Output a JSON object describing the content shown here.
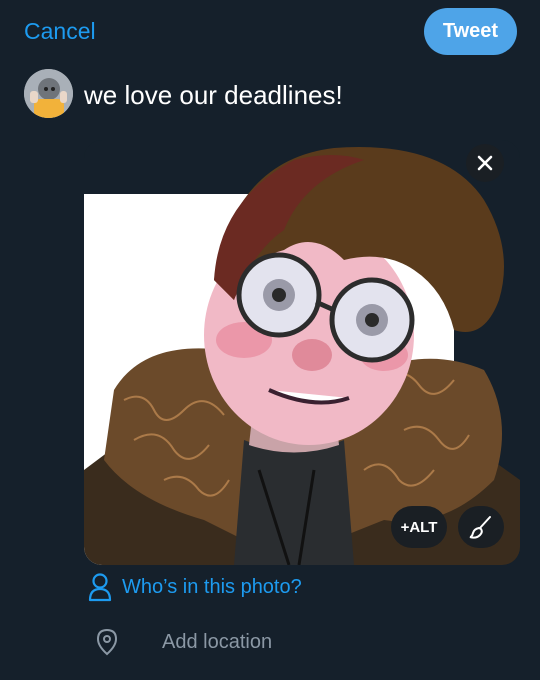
{
  "header": {
    "cancel_label": "Cancel",
    "tweet_label": "Tweet"
  },
  "composer": {
    "text": "we love our deadlines!"
  },
  "media": {
    "alt_label": "+ALT",
    "remove_icon": "close-icon",
    "edit_icon": "paintbrush-icon"
  },
  "tag_people": {
    "label": "Who’s in this photo?",
    "icon": "person-icon"
  },
  "location": {
    "label": "Add location",
    "icon": "location-pin-icon"
  },
  "colors": {
    "background": "#15202b",
    "accent": "#1d9bf0",
    "tweet_button": "#4ea4e8",
    "muted_text": "#8b98a5"
  }
}
